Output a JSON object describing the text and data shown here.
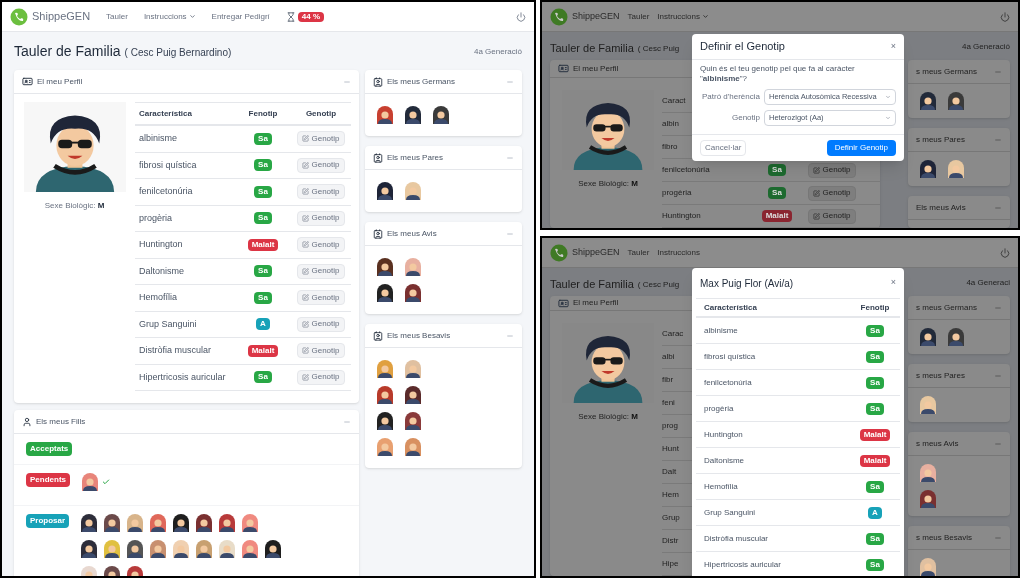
{
  "main_screen": {
    "navbar": {
      "brand": "ShippeGEN",
      "links": [
        {
          "label": "Tauler",
          "dropdown": false
        },
        {
          "label": "Instruccions",
          "dropdown": true
        },
        {
          "label": "Entregar Pedigrí",
          "dropdown": false
        }
      ],
      "timer_badge": "44 %"
    },
    "title": "Tauler de Familia",
    "person": "( Cesc Puig Bernardino)",
    "generation": "4a Generació",
    "profile": {
      "title": "El meu Perfil",
      "sex_label": "Sexe Biològic:",
      "sex": "M",
      "columns": [
        "Característica",
        "Fenotip",
        "Genotip"
      ],
      "rows": [
        {
          "trait": "albinisme",
          "phenotype": "Sa",
          "kind": "healthy",
          "button": "Genotip"
        },
        {
          "trait": "fibrosi quística",
          "phenotype": "Sa",
          "kind": "healthy",
          "button": "Genotip"
        },
        {
          "trait": "fenilcetonúria",
          "phenotype": "Sa",
          "kind": "healthy",
          "button": "Genotip"
        },
        {
          "trait": "progèria",
          "phenotype": "Sa",
          "kind": "healthy",
          "button": "Genotip"
        },
        {
          "trait": "Huntington",
          "phenotype": "Malalt",
          "kind": "sick",
          "button": "Genotip"
        },
        {
          "trait": "Daltonisme",
          "phenotype": "Sa",
          "kind": "healthy",
          "button": "Genotip"
        },
        {
          "trait": "Hemofília",
          "phenotype": "Sa",
          "kind": "healthy",
          "button": "Genotip"
        },
        {
          "trait": "Grup Sanguini",
          "phenotype": "A",
          "kind": "blood",
          "button": "Genotip"
        },
        {
          "trait": "Distròfia muscular",
          "phenotype": "Malalt",
          "kind": "sick",
          "button": "Genotip"
        },
        {
          "trait": "Hipertricosis auricular",
          "phenotype": "Sa",
          "kind": "healthy",
          "button": "Genotip"
        }
      ]
    },
    "children": {
      "title": "Els meus Fills",
      "groups": [
        {
          "label": "Acceptats",
          "kind": "accepted"
        },
        {
          "label": "Pendents",
          "kind": "pending",
          "confirmed": true,
          "avatar_rows": [
            [
              {
                "color": "#e8857a"
              }
            ]
          ]
        },
        {
          "label": "Proposar",
          "kind": "propose",
          "avatar_rows": [
            [
              {
                "color": "#2d2d3a"
              },
              {
                "color": "#6b4a4a"
              },
              {
                "color": "#d8b48a"
              },
              {
                "color": "#e0685a"
              },
              {
                "color": "#1e1e1e"
              },
              {
                "color": "#7a3030"
              },
              {
                "color": "#b83a3a"
              },
              {
                "color": "#f08a80"
              }
            ],
            [
              {
                "color": "#2d2d3a"
              },
              {
                "color": "#e0c040"
              },
              {
                "color": "#555555"
              },
              {
                "color": "#c89070"
              },
              {
                "color": "#f0d0b0"
              },
              {
                "color": "#c8a070"
              },
              {
                "color": "#e8dcc8"
              },
              {
                "color": "#f08a80"
              },
              {
                "color": "#1e1e1e"
              }
            ],
            [
              {
                "color": "#e8d8d0"
              },
              {
                "color": "#6b4a4a"
              },
              {
                "color": "#b83a3a"
              }
            ]
          ]
        }
      ]
    },
    "side_panels": [
      {
        "title": "Els meus Germans",
        "avatar_rows": [
          [
            {
              "color": "#c84030"
            },
            {
              "color": "#222a3a"
            },
            {
              "color": "#3a3a3a"
            }
          ]
        ]
      },
      {
        "title": "Els meus Pares",
        "avatar_rows": [
          [
            {
              "color": "#1e2438"
            },
            {
              "color": "#e8c8a0"
            }
          ]
        ]
      },
      {
        "title": "Els meus Avis",
        "avatar_rows": [
          [
            {
              "color": "#5a3020"
            },
            {
              "color": "#e8b0a0"
            }
          ],
          [
            {
              "color": "#222222"
            },
            {
              "color": "#7a3030"
            }
          ]
        ]
      },
      {
        "title": "Els meus Besavis",
        "avatar_rows": [
          [
            {
              "color": "#e0a040"
            },
            {
              "color": "#e0c0a0"
            }
          ],
          [
            {
              "color": "#b83a2a"
            },
            {
              "color": "#5a2a2a"
            }
          ],
          [
            {
              "color": "#222222"
            },
            {
              "color": "#8a3a3a"
            }
          ],
          [
            {
              "color": "#e8a070"
            },
            {
              "color": "#d89060"
            }
          ]
        ]
      }
    ]
  },
  "genotype_screen": {
    "background": {
      "navbar": {
        "brand": "ShippeGEN",
        "links": [
          {
            "label": "Tauler",
            "dropdown": false
          },
          {
            "label": "Instruccions",
            "dropdown": true
          }
        ]
      },
      "title": "Tauler de Familia",
      "person": "( Cesc Puig",
      "generation": "4a Generació",
      "profile_title": "El meu Perfil",
      "sex_label": "Sexe Biològic:",
      "sex": "M",
      "rows": [
        {
          "trait": "Caract"
        },
        {
          "trait": "albin"
        },
        {
          "trait": "fibro"
        },
        {
          "trait": "fenilcetonúria",
          "phenotype": "Sa",
          "kind": "healthy",
          "button": "Genotip"
        },
        {
          "trait": "progèria",
          "phenotype": "Sa",
          "kind": "healthy",
          "button": "Genotip"
        },
        {
          "trait": "Huntington",
          "phenotype": "Malalt",
          "kind": "sick",
          "button": "Genotip"
        }
      ],
      "side_panels": [
        {
          "title": "s meus Germans",
          "avatar_rows": [
            [
              {
                "color": "#222a3a"
              },
              {
                "color": "#3a3a3a"
              }
            ]
          ]
        },
        {
          "title": "s meus Pares",
          "avatar_rows": [
            [
              {
                "color": "#1e2438"
              },
              {
                "color": "#e8c8a0"
              }
            ]
          ]
        },
        {
          "title": "Els meus Avis"
        }
      ]
    },
    "modal": {
      "title": "Definir el Genotip",
      "close": "×",
      "question": "Quin és el teu genotip pel que fa al caràcter \"**albinisme**\"?",
      "fields": [
        {
          "label": "Patró d'herència",
          "value": "Herència Autosòmica Recessiva"
        },
        {
          "label": "Genotip",
          "value": "Heterozigot (Aa)"
        }
      ],
      "cancel": "Cancel·lar",
      "submit": "Definir Genotip"
    }
  },
  "relative_screen": {
    "background": {
      "navbar": {
        "brand": "ShippeGEN",
        "links": [
          {
            "label": "Tauler",
            "dropdown": false
          },
          {
            "label": "Instruccions",
            "dropdown": false
          }
        ]
      },
      "title": "Tauler de Familia",
      "person": "( Cesc Puig",
      "generation": "4a Generaci",
      "profile_title": "El meu Perfil",
      "sex_label": "Sexe Biològic:",
      "sex": "M",
      "rows": [
        {
          "trait": "Carac"
        },
        {
          "trait": "albi"
        },
        {
          "trait": "fibr"
        },
        {
          "trait": "feni"
        },
        {
          "trait": "prog"
        },
        {
          "trait": "Hunt"
        },
        {
          "trait": "Dalt"
        },
        {
          "trait": "Hem"
        },
        {
          "trait": "Grup"
        },
        {
          "trait": "Distr"
        },
        {
          "trait": "Hipe"
        }
      ],
      "side_panels": [
        {
          "title": "s meus Germans",
          "avatar_rows": [
            [
              {
                "color": "#222a3a"
              },
              {
                "color": "#3a3a3a"
              }
            ]
          ]
        },
        {
          "title": "s meus Pares",
          "avatar_rows": [
            [
              {
                "color": "#e8c8a0"
              }
            ]
          ]
        },
        {
          "title": "s meus Avis",
          "avatar_rows": [
            [
              {
                "color": "#e8b0a0"
              }
            ],
            [
              {
                "color": "#7a3030"
              }
            ]
          ]
        },
        {
          "title": "s meus Besavis",
          "avatar_rows": [
            [
              {
                "color": "#e0c0a0"
              }
            ]
          ]
        }
      ]
    },
    "modal": {
      "title": "Max Puig Flor (Avi/a)",
      "close": "×",
      "columns": [
        "Característica",
        "Fenotip"
      ],
      "rows": [
        {
          "trait": "albinisme",
          "phenotype": "Sa",
          "kind": "healthy"
        },
        {
          "trait": "fibrosi quística",
          "phenotype": "Sa",
          "kind": "healthy"
        },
        {
          "trait": "fenilcetonúria",
          "phenotype": "Sa",
          "kind": "healthy"
        },
        {
          "trait": "progèria",
          "phenotype": "Sa",
          "kind": "healthy"
        },
        {
          "trait": "Huntington",
          "phenotype": "Malalt",
          "kind": "sick"
        },
        {
          "trait": "Daltonisme",
          "phenotype": "Malalt",
          "kind": "sick"
        },
        {
          "trait": "Hemofília",
          "phenotype": "Sa",
          "kind": "healthy"
        },
        {
          "trait": "Grup Sanguini",
          "phenotype": "A",
          "kind": "blood"
        },
        {
          "trait": "Distròfia muscular",
          "phenotype": "Sa",
          "kind": "healthy"
        },
        {
          "trait": "Hipertricosis auricular",
          "phenotype": "Sa",
          "kind": "healthy"
        }
      ]
    }
  }
}
